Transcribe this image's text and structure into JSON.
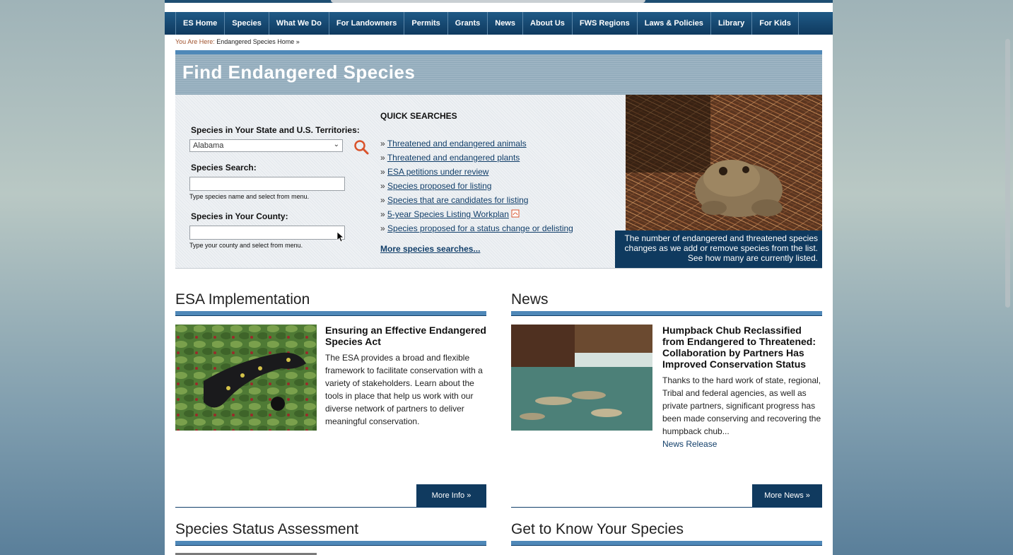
{
  "nav": {
    "items": [
      "ES Home",
      "Species",
      "What We Do",
      "For Landowners",
      "Permits",
      "Grants",
      "News",
      "About Us",
      "FWS Regions",
      "Laws & Policies",
      "Library",
      "For Kids"
    ]
  },
  "breadcrumb": {
    "label": "You Are Here:",
    "path": "Endangered Species Home »"
  },
  "find": {
    "title": "Find Endangered Species",
    "state_label": "Species in Your State and U.S. Territories:",
    "state_selected": "Alabama",
    "search_label": "Species Search:",
    "search_value": "",
    "search_hint": "Type species name and select from menu.",
    "county_label": "Species in Your County:",
    "county_value": "",
    "county_hint": "Type your county and select from menu."
  },
  "quick": {
    "title": "QUICK SEARCHES",
    "bullet": "»",
    "links": [
      "Threatened and endangered animals",
      "Threatened and endangered plants",
      "ESA petitions under review",
      "Species proposed for listing",
      "Species that are candidates for listing",
      "5-year Species Listing Workplan",
      "Species proposed for a status change or delisting"
    ],
    "more": "More species searches..."
  },
  "photo_caption": "The number of endangered and threatened species changes as we add or remove species from the list. See how many are currently listed.",
  "esa": {
    "title": "ESA Implementation",
    "headline": "Ensuring an Effective Endangered Species Act",
    "body": "The ESA provides a broad and flexible framework to facilitate conservation with a variety of stakeholders. Learn about the tools in place that help us work with our diverse network of partners to deliver meaningful conservation.",
    "button": "More Info »"
  },
  "news": {
    "title": "News",
    "headline": "Humpback Chub Reclassified from Endangered to Threatened: Collaboration by Partners Has Improved Conservation Status",
    "body": "Thanks to the hard work of state, regional, Tribal and federal agencies, as well as private partners, significant progress has been made conserving and recovering the humpback chub...",
    "link": "News Release",
    "button": "More News »"
  },
  "ssa": {
    "title": "Species Status Assessment"
  },
  "gtk": {
    "title": "Get to Know Your Species"
  },
  "colors": {
    "nav_bg": "#0f3a5f",
    "accent_bar": "#4f88b8",
    "link": "#123f6a",
    "breadcrumb_label": "#a0522d"
  }
}
